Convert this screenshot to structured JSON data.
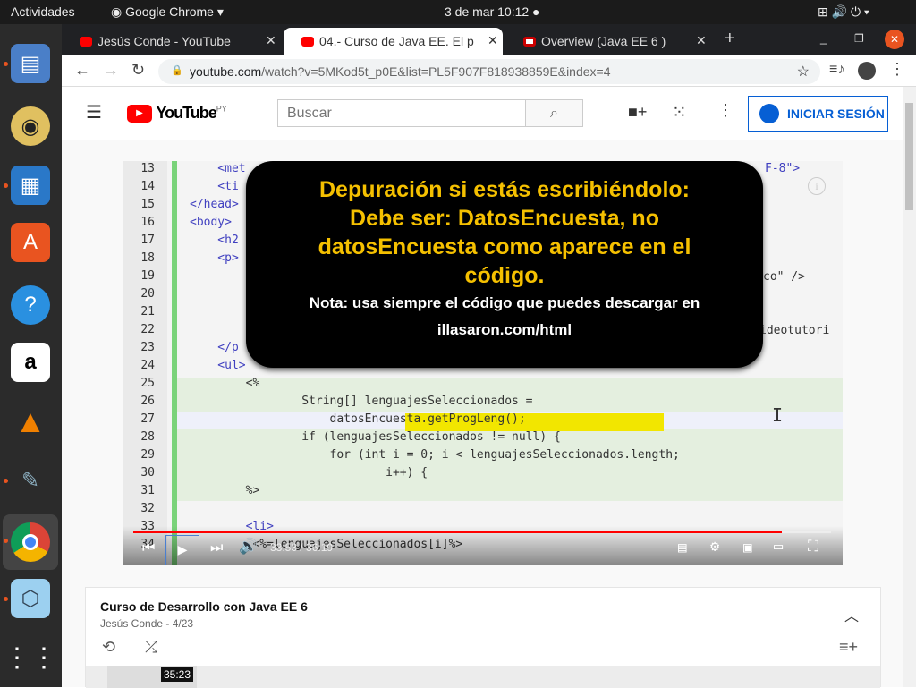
{
  "topbar": {
    "activities": "Actividades",
    "app": "Google Chrome ▾",
    "datetime": "3 de mar  10:12 ●",
    "tray": "⊞  🔊  ⏻ ▾"
  },
  "dock": [
    "files",
    "rhythmbox",
    "writer",
    "software",
    "help",
    "amazon",
    "vlc",
    "paint",
    "chrome",
    "box",
    "apps"
  ],
  "tabs": [
    {
      "title": "Jesús Conde - YouTube"
    },
    {
      "title": "04.- Curso de Java EE. El p"
    },
    {
      "title": "Overview (Java EE 6 )"
    }
  ],
  "address": {
    "host": "youtube.com",
    "path": "/watch?v=5MKod5t_p0E&list=PL5F907F818938859E&index=4"
  },
  "youtube": {
    "logo": "YouTube",
    "region": "PY",
    "search_placeholder": "Buscar",
    "signin": "INICIAR SESIÓN"
  },
  "video": {
    "lines": [
      {
        "n": "13",
        "code": "    <met",
        "c": "#4040c0"
      },
      {
        "n": "14",
        "code": "    <ti",
        "c": "#4040c0"
      },
      {
        "n": "15",
        "code": "</head>",
        "c": "#4040c0"
      },
      {
        "n": "16",
        "code": "<body>",
        "c": "#4040c0"
      },
      {
        "n": "17",
        "code": "    <h2",
        "c": "#4040c0"
      },
      {
        "n": "18",
        "code": "    <p>",
        "c": "#4040c0"
      },
      {
        "n": "19",
        "code": "",
        "c": "#333"
      },
      {
        "n": "20",
        "code": "",
        "c": "#333"
      },
      {
        "n": "21",
        "code": "",
        "c": "#333"
      },
      {
        "n": "22",
        "code": "",
        "c": "#333"
      },
      {
        "n": "23",
        "code": "    </p",
        "c": "#4040c0"
      },
      {
        "n": "24",
        "code": "    <ul>",
        "c": "#4040c0"
      },
      {
        "n": "25",
        "code": "        <%",
        "c": "#333"
      },
      {
        "n": "26",
        "code": "                String[] lenguajesSeleccionados =",
        "c": "#333"
      },
      {
        "n": "27",
        "code": "                    datosEncuesta.getProgLeng();",
        "c": "#333"
      },
      {
        "n": "28",
        "code": "                if (lenguajesSeleccionados != null) {",
        "c": "#333"
      },
      {
        "n": "29",
        "code": "                    for (int i = 0; i < lenguajesSeleccionados.length;",
        "c": "#333"
      },
      {
        "n": "30",
        "code": "                            i++) {",
        "c": "#333"
      },
      {
        "n": "31",
        "code": "        %>",
        "c": "#333"
      },
      {
        "n": "32",
        "code": "",
        "c": "#333"
      },
      {
        "n": "33",
        "code": "        <li>",
        "c": "#4040c0"
      },
      {
        "n": "34",
        "code": "         <%=lenguajesSeleccionados[i]%>",
        "c": "#333"
      }
    ],
    "right_fragments": {
      "r13": "F-8\">",
      "r19": "co\" />",
      "r22": "ideotutori"
    },
    "overlay": {
      "l1": "Depuración si estás escribiéndolo:",
      "l2": "Debe ser: DatosEncuesta, no",
      "l3": "datosEncuesta como aparece en el",
      "l4": "código.",
      "note1": "Nota: usa siempre el código que puedes descargar en",
      "note2": "illasaron.com/html"
    },
    "time": "33:53 / 36:19",
    "progress": 0.93
  },
  "playlist": {
    "title": "Curso de Desarrollo con Java EE 6",
    "sub": "Jesús Conde - 4/23",
    "thumb_duration": "35:23"
  }
}
